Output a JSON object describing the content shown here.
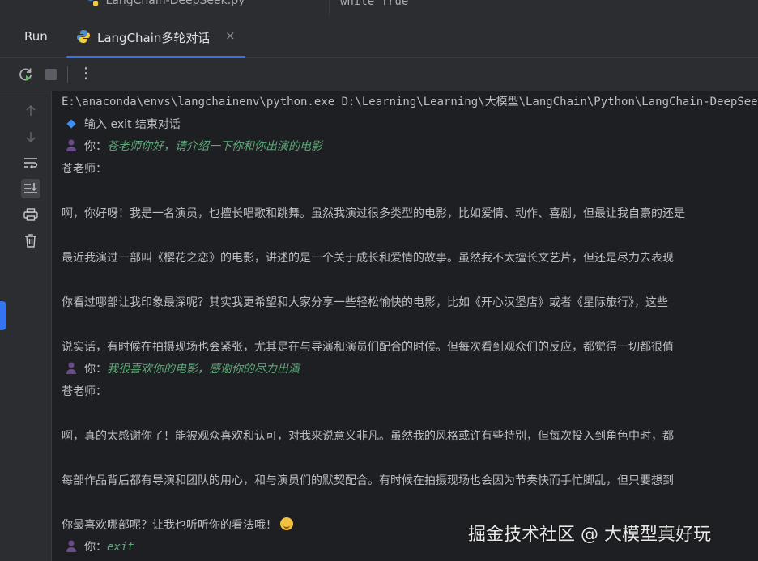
{
  "top": {
    "file_tab": "LangChain-DeepSeek.py",
    "code_snippet": "while True"
  },
  "tabbar": {
    "run_label": "Run",
    "run_tab_title": "LangChain多轮对话",
    "close_glyph": "×"
  },
  "toolbar": {
    "icons": [
      "rerun-icon",
      "stop-icon",
      "more-icon"
    ],
    "more_glyph": "⋮"
  },
  "gutter": {
    "icons": [
      "arrow-up-icon",
      "arrow-down-icon",
      "soft-wrap-icon",
      "scroll-to-end-icon",
      "print-icon",
      "trash-icon"
    ]
  },
  "console": {
    "command": "E:\\anaconda\\envs\\langchainenv\\python.exe D:\\Learning\\Learning\\大模型\\LangChain\\Python\\LangChain-DeepSeek.py",
    "hint": "输入 exit 结束对话",
    "user_prefix": "你：",
    "ai_name": "苍老师：",
    "user_input_1": "苍老师你好，请介绍一下你和你出演的电影",
    "reply_1": [
      "啊，你好呀！我是一名演员，也擅长唱歌和跳舞。虽然我演过很多类型的电影，比如爱情、动作、喜剧，但最让我自豪的还是",
      "最近我演过一部叫《樱花之恋》的电影，讲述的是一个关于成长和爱情的故事。虽然我不太擅长文艺片，但还是尽力去表现",
      "你看过哪部让我印象最深呢？其实我更希望和大家分享一些轻松愉快的电影，比如《开心汉堡店》或者《星际旅行》，这些",
      "说实话，有时候在拍摄现场也会紧张，尤其是在与导演和演员们配合的时候。但每次看到观众们的反应，都觉得一切都很值"
    ],
    "user_input_2": "我很喜欢你的电影，感谢你的尽力出演",
    "reply_2": [
      "啊，真的太感谢你了！能被观众喜欢和认可，对我来说意义非凡。虽然我的风格或许有些特别，但每次投入到角色中时，都",
      "每部作品背后都有导演和团队的用心，和与演员们的默契配合。有时候在拍摄现场也会因为节奏快而手忙脚乱，但只要想到",
      "你最喜欢哪部呢？让我也听听你的看法哦！"
    ],
    "user_input_3": "exit"
  },
  "watermark": "掘金技术社区 @ 大模型真好玩",
  "colors": {
    "background": "#1e1f22",
    "panel": "#2b2d30",
    "text": "#bcbec4",
    "user_input": "#5fa87a",
    "accent": "#3574f0"
  }
}
